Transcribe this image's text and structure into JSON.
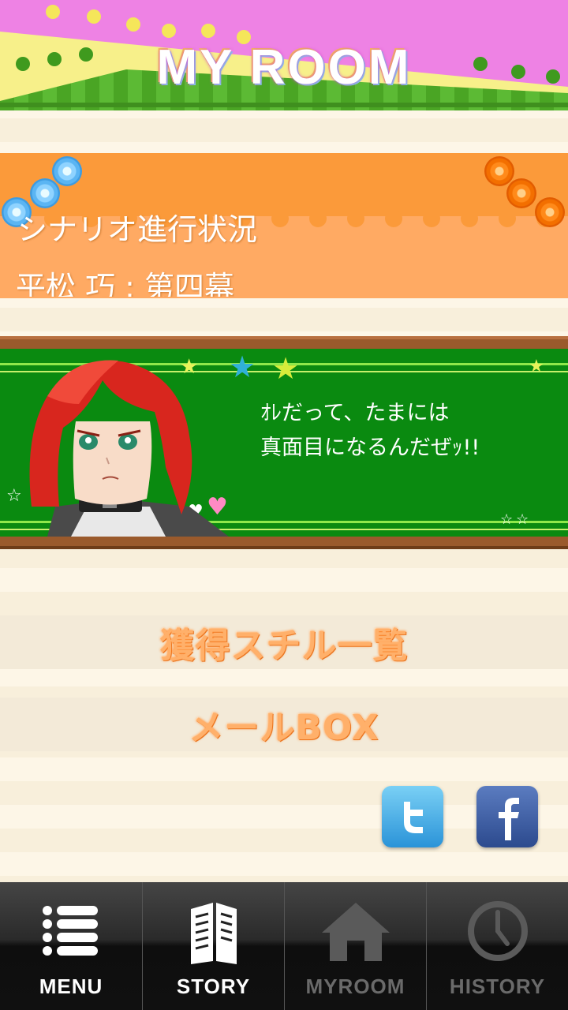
{
  "header": {
    "title": "MY ROOM"
  },
  "progress": {
    "label": "シナリオ進行状況",
    "value": "平松 巧 : 第四幕"
  },
  "character": {
    "line1": "ｵﾚだって、たまには",
    "line2": "真面目になるんだぜｯ!!"
  },
  "menu": {
    "stills_label": "獲得スチル一覧",
    "mail_label": "メールBOX"
  },
  "social": {
    "twitter_icon": "twitter-icon",
    "facebook_icon": "facebook-icon"
  },
  "tabs": [
    {
      "label": "MENU",
      "icon": "menu-list-icon",
      "active": true
    },
    {
      "label": "STORY",
      "icon": "book-icon",
      "active": true
    },
    {
      "label": "MYROOM",
      "icon": "house-icon",
      "active": false
    },
    {
      "label": "HISTORY",
      "icon": "clock-icon",
      "active": false
    }
  ],
  "colors": {
    "header_pink": "#ee82e4",
    "header_yellow": "#f7f08a",
    "progress_orange": "#fb9a3a",
    "board_green": "#0a8a10",
    "twitter_blue": "#3fa9e6",
    "facebook_blue": "#3b5998"
  }
}
